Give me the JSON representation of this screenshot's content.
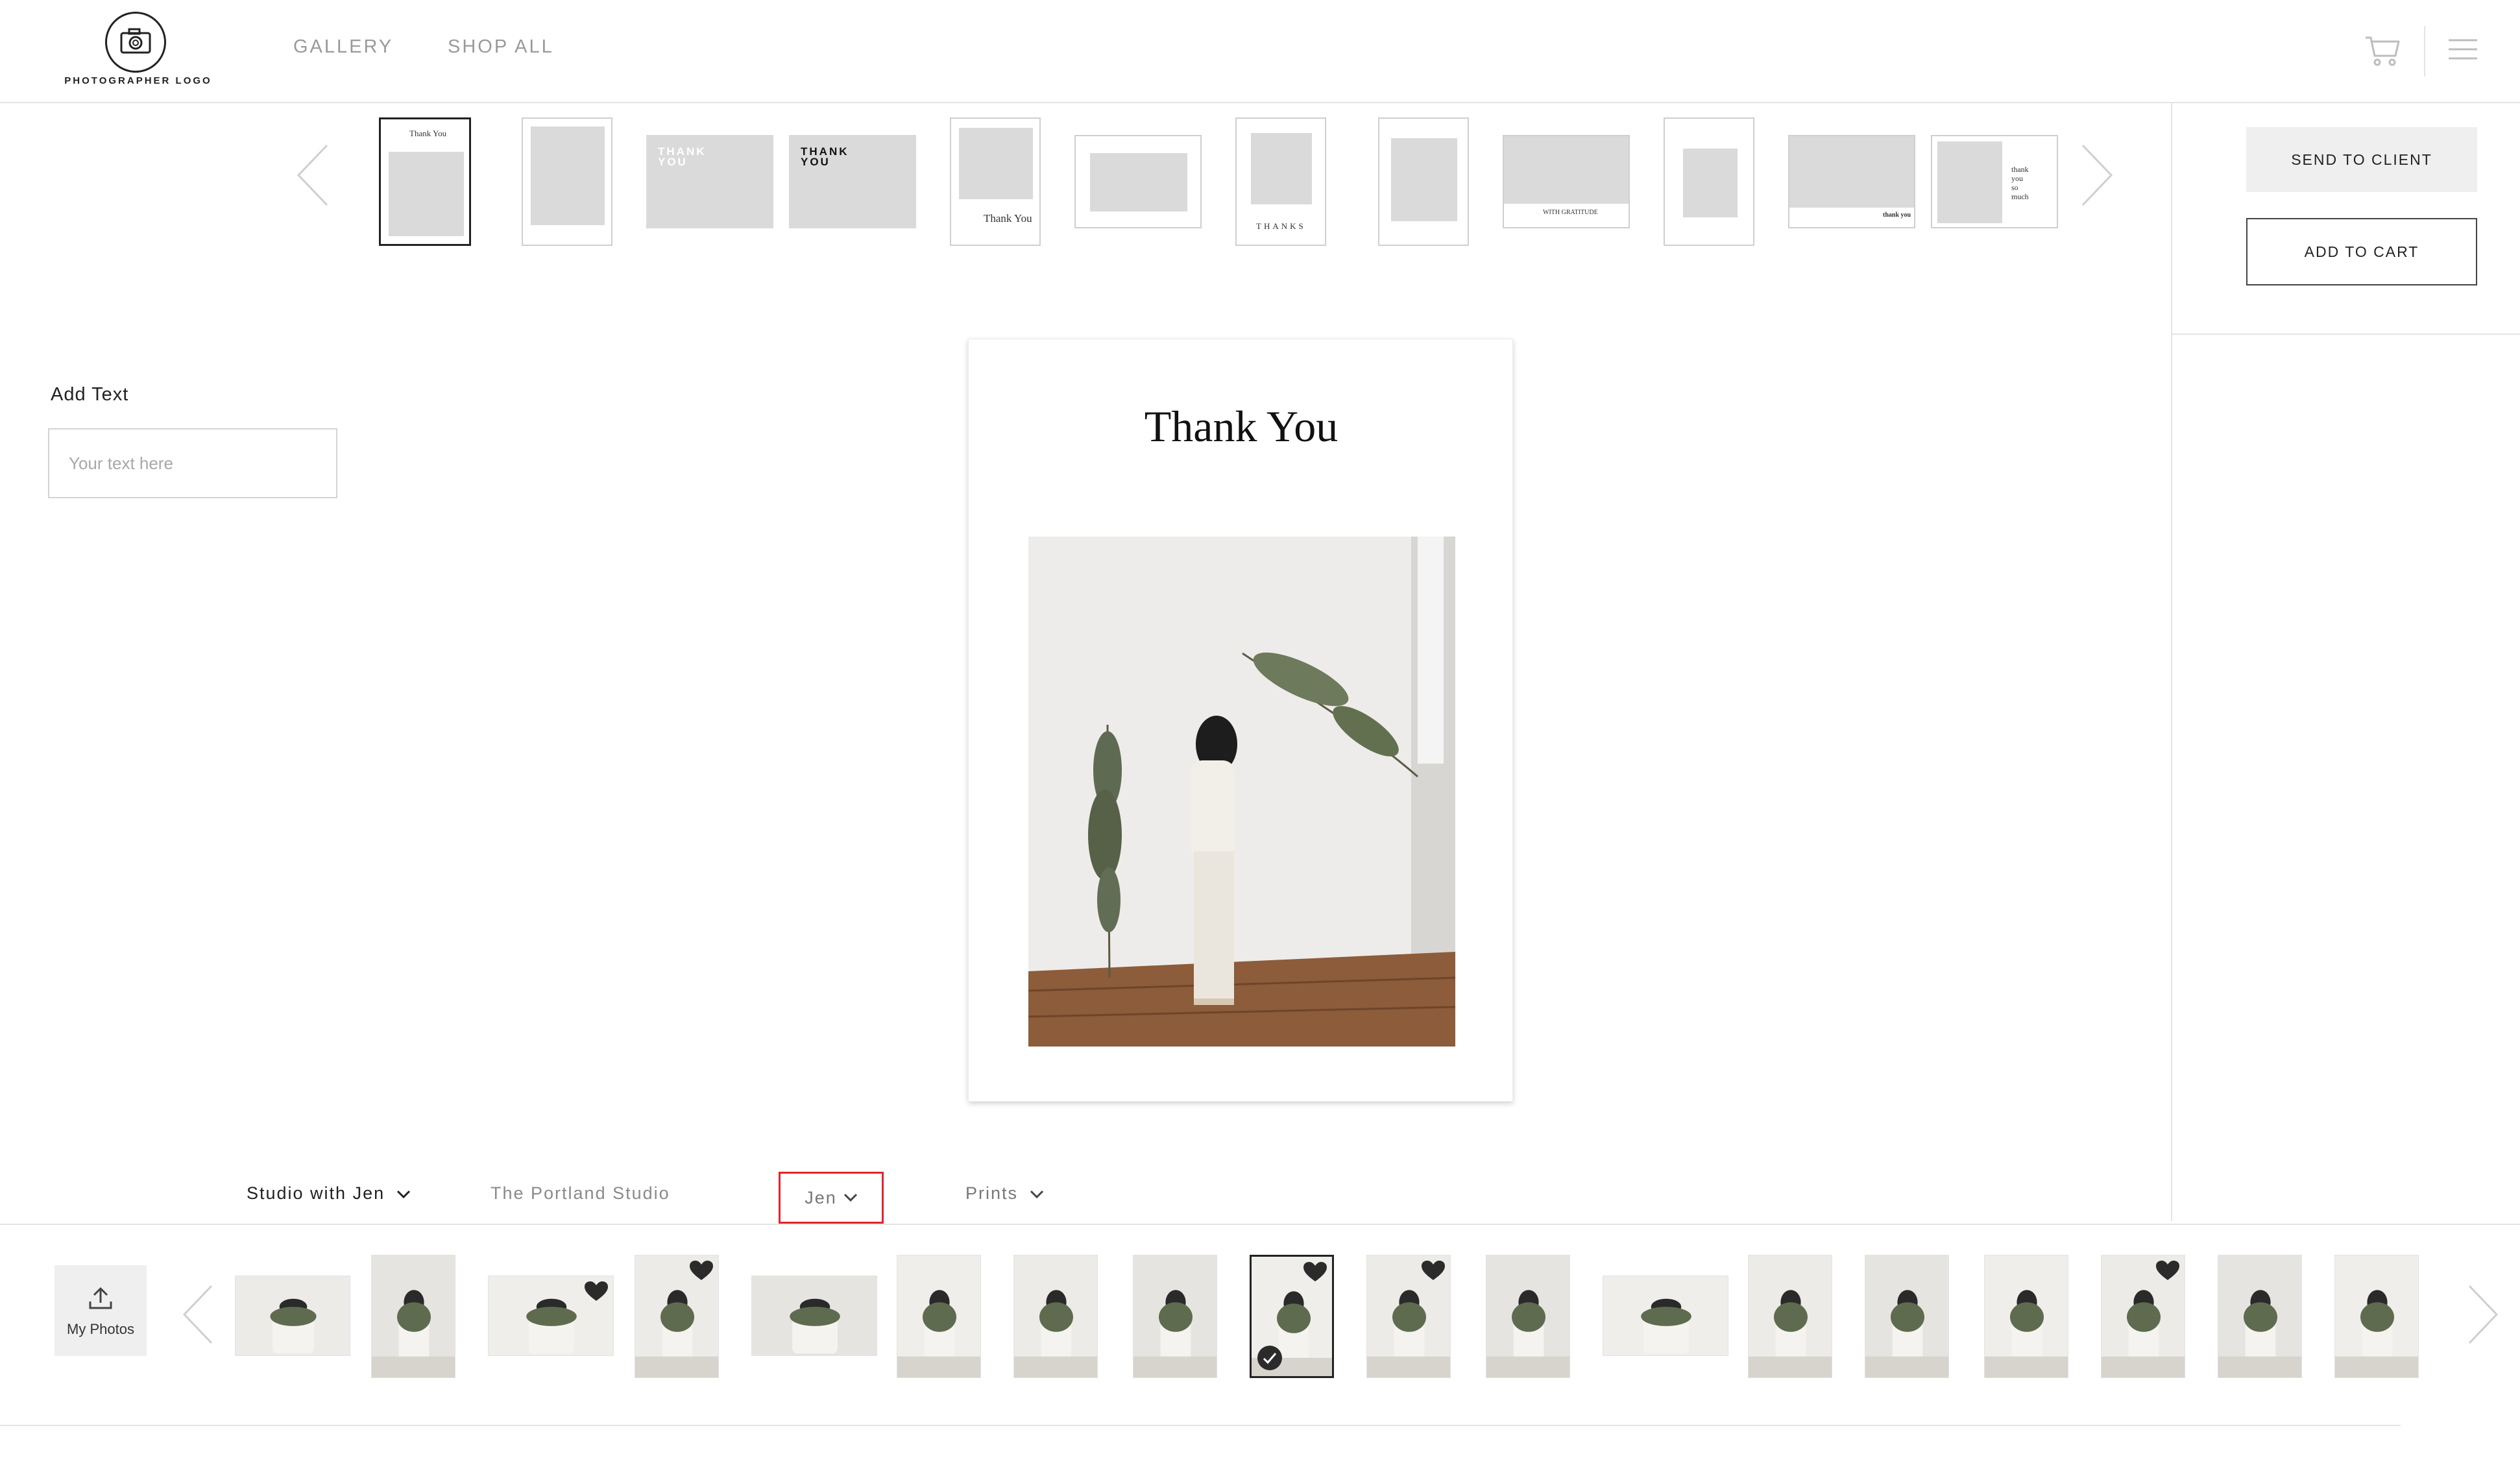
{
  "header": {
    "logo_text": "PHOTOGRAPHER LOGO",
    "nav": [
      "GALLERY",
      "SHOP ALL"
    ],
    "icons": [
      "camera-icon",
      "cart-icon",
      "hamburger-menu-icon"
    ]
  },
  "actions": {
    "send_label": "SEND TO CLIENT",
    "cart_label": "ADD TO CART"
  },
  "templates": {
    "count": 12,
    "selected_index": 0,
    "items": [
      {
        "lines": [
          "Thank You"
        ]
      },
      {
        "lines": []
      },
      {
        "lines": [
          "THANK",
          "YOU"
        ]
      },
      {
        "lines": [
          "THANK",
          "YOU"
        ]
      },
      {
        "lines": [
          "Thank You"
        ]
      },
      {
        "lines": []
      },
      {
        "lines": [
          "THANKS"
        ]
      },
      {
        "lines": []
      },
      {
        "lines": [
          "WITH GRATITUDE"
        ]
      },
      {
        "lines": []
      },
      {
        "lines": [
          "thank you"
        ]
      },
      {
        "lines": [
          "thank",
          "you",
          "so",
          "much"
        ]
      }
    ]
  },
  "add_text": {
    "label": "Add Text",
    "placeholder": "Your text here"
  },
  "card": {
    "title": "Thank You"
  },
  "filters": {
    "album": "Studio with Jen",
    "location": "The Portland Studio",
    "person": "Jen",
    "type": "Prints"
  },
  "photos": {
    "my_photos_label": "My Photos",
    "count": 19,
    "selected_index": 8,
    "favorites": [
      2,
      3,
      8,
      9,
      15
    ]
  },
  "colors": {
    "highlight": "#e0262b",
    "accent": "#222222",
    "placeholder_gray": "#dadada"
  }
}
